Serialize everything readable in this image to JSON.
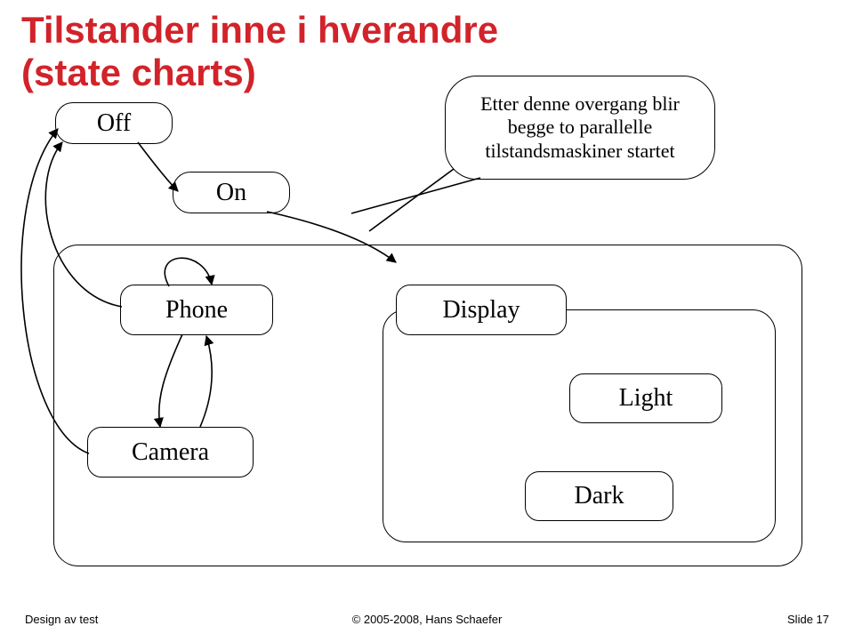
{
  "title": {
    "line1": "Tilstander inne i hverandre",
    "line2": "(state charts)"
  },
  "states": {
    "off": "Off",
    "on": "On",
    "phone": "Phone",
    "camera": "Camera",
    "display": "Display",
    "light": "Light",
    "dark": "Dark"
  },
  "callout": {
    "line1": "Etter denne overgang blir",
    "line2": "begge to parallelle",
    "line3": "tilstandsmaskiner startet"
  },
  "footer": {
    "left": "Design av test",
    "center": "© 2005-2008, Hans Schaefer",
    "right": "Slide 17"
  }
}
